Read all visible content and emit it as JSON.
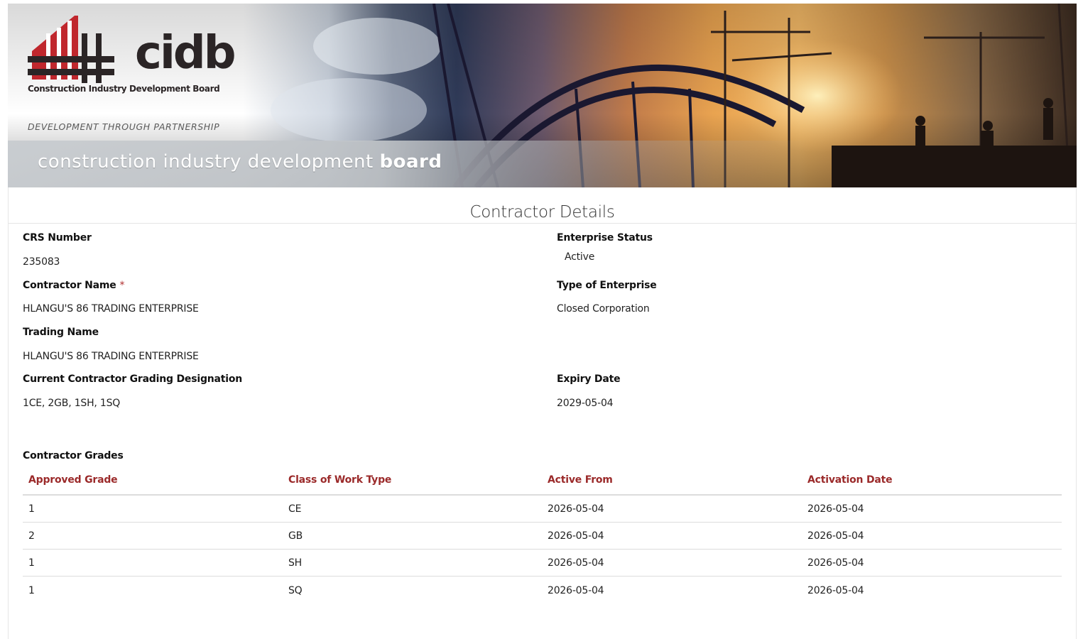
{
  "banner": {
    "logo_text": "cidb",
    "logo_subtitle": "Construction Industry Development Board",
    "tagline": "DEVELOPMENT THROUGH PARTNERSHIP",
    "band_text_light": "construction industry development ",
    "band_text_bold": "board",
    "logo_red": "#c0272d",
    "logo_dark": "#2b2526"
  },
  "page_title": "Contractor Details",
  "fields": {
    "crs_number": {
      "label": "CRS Number",
      "value": "235083"
    },
    "enterprise_status": {
      "label": "Enterprise Status",
      "value": "Active"
    },
    "contractor_name": {
      "label": "Contractor Name",
      "required_marker": "*",
      "value": "HLANGU'S 86 TRADING ENTERPRISE"
    },
    "type_of_enterprise": {
      "label": "Type of Enterprise",
      "value": "Closed Corporation"
    },
    "trading_name": {
      "label": "Trading Name",
      "value": "HLANGU'S 86 TRADING ENTERPRISE"
    },
    "grading_designation": {
      "label": "Current Contractor Grading Designation",
      "value": "1CE, 2GB, 1SH, 1SQ"
    },
    "expiry_date": {
      "label": "Expiry Date",
      "value": "2029-05-04"
    }
  },
  "grades_table": {
    "title": "Contractor Grades",
    "header_color": "#9b2a2a",
    "columns": [
      "Approved Grade",
      "Class of Work Type",
      "Active From",
      "Activation Date"
    ],
    "rows": [
      [
        "1",
        "CE",
        "2026-05-04",
        "2026-05-04"
      ],
      [
        "2",
        "GB",
        "2026-05-04",
        "2026-05-04"
      ],
      [
        "1",
        "SH",
        "2026-05-04",
        "2026-05-04"
      ],
      [
        "1",
        "SQ",
        "2026-05-04",
        "2026-05-04"
      ]
    ]
  }
}
